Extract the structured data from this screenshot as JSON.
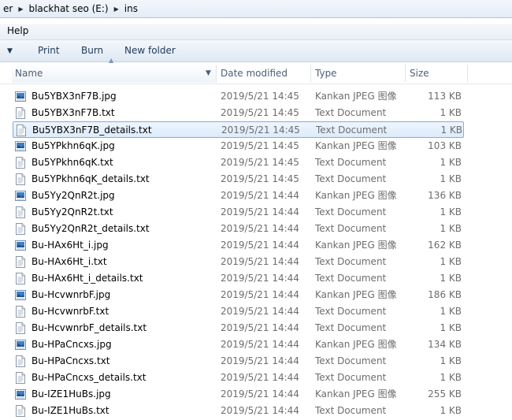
{
  "address": {
    "crumbs": [
      "er",
      "blackhat seo (E:)",
      "ins"
    ]
  },
  "menu": {
    "help": "Help"
  },
  "commands": {
    "print": "Print",
    "burn": "Burn",
    "new_folder": "New folder"
  },
  "columns": {
    "name": "Name",
    "date": "Date modified",
    "type": "Type",
    "size": "Size"
  },
  "files": [
    {
      "name": "Bu5YBX3nF7B.jpg",
      "date": "2019/5/21 14:45",
      "type": "Kankan JPEG 图像",
      "size": "113 KB",
      "icon": "jpeg-file-icon",
      "selected": false
    },
    {
      "name": "Bu5YBX3nF7B.txt",
      "date": "2019/5/21 14:45",
      "type": "Text Document",
      "size": "1 KB",
      "icon": "text-file-icon",
      "selected": false
    },
    {
      "name": "Bu5YBX3nF7B_details.txt",
      "date": "2019/5/21 14:45",
      "type": "Text Document",
      "size": "1 KB",
      "icon": "text-file-icon",
      "selected": true
    },
    {
      "name": "Bu5YPkhn6qK.jpg",
      "date": "2019/5/21 14:45",
      "type": "Kankan JPEG 图像",
      "size": "103 KB",
      "icon": "jpeg-file-icon",
      "selected": false
    },
    {
      "name": "Bu5YPkhn6qK.txt",
      "date": "2019/5/21 14:45",
      "type": "Text Document",
      "size": "1 KB",
      "icon": "text-file-icon",
      "selected": false
    },
    {
      "name": "Bu5YPkhn6qK_details.txt",
      "date": "2019/5/21 14:45",
      "type": "Text Document",
      "size": "1 KB",
      "icon": "text-file-icon",
      "selected": false
    },
    {
      "name": "Bu5Yy2QnR2t.jpg",
      "date": "2019/5/21 14:44",
      "type": "Kankan JPEG 图像",
      "size": "136 KB",
      "icon": "jpeg-file-icon",
      "selected": false
    },
    {
      "name": "Bu5Yy2QnR2t.txt",
      "date": "2019/5/21 14:44",
      "type": "Text Document",
      "size": "1 KB",
      "icon": "text-file-icon",
      "selected": false
    },
    {
      "name": "Bu5Yy2QnR2t_details.txt",
      "date": "2019/5/21 14:44",
      "type": "Text Document",
      "size": "1 KB",
      "icon": "text-file-icon",
      "selected": false
    },
    {
      "name": "Bu-HAx6Ht_i.jpg",
      "date": "2019/5/21 14:44",
      "type": "Kankan JPEG 图像",
      "size": "162 KB",
      "icon": "jpeg-file-icon",
      "selected": false
    },
    {
      "name": "Bu-HAx6Ht_i.txt",
      "date": "2019/5/21 14:44",
      "type": "Text Document",
      "size": "1 KB",
      "icon": "text-file-icon",
      "selected": false
    },
    {
      "name": "Bu-HAx6Ht_i_details.txt",
      "date": "2019/5/21 14:44",
      "type": "Text Document",
      "size": "1 KB",
      "icon": "text-file-icon",
      "selected": false
    },
    {
      "name": "Bu-HcvwnrbF.jpg",
      "date": "2019/5/21 14:44",
      "type": "Kankan JPEG 图像",
      "size": "186 KB",
      "icon": "jpeg-file-icon",
      "selected": false
    },
    {
      "name": "Bu-HcvwnrbF.txt",
      "date": "2019/5/21 14:44",
      "type": "Text Document",
      "size": "1 KB",
      "icon": "text-file-icon",
      "selected": false
    },
    {
      "name": "Bu-HcvwnrbF_details.txt",
      "date": "2019/5/21 14:44",
      "type": "Text Document",
      "size": "1 KB",
      "icon": "text-file-icon",
      "selected": false
    },
    {
      "name": "Bu-HPaCncxs.jpg",
      "date": "2019/5/21 14:44",
      "type": "Kankan JPEG 图像",
      "size": "134 KB",
      "icon": "jpeg-file-icon",
      "selected": false
    },
    {
      "name": "Bu-HPaCncxs.txt",
      "date": "2019/5/21 14:44",
      "type": "Text Document",
      "size": "1 KB",
      "icon": "text-file-icon",
      "selected": false
    },
    {
      "name": "Bu-HPaCncxs_details.txt",
      "date": "2019/5/21 14:44",
      "type": "Text Document",
      "size": "1 KB",
      "icon": "text-file-icon",
      "selected": false
    },
    {
      "name": "Bu-IZE1HuBs.jpg",
      "date": "2019/5/21 14:44",
      "type": "Kankan JPEG 图像",
      "size": "255 KB",
      "icon": "jpeg-file-icon",
      "selected": false
    },
    {
      "name": "Bu-IZE1HuBs.txt",
      "date": "2019/5/21 14:44",
      "type": "Text Document",
      "size": "1 KB",
      "icon": "text-file-icon",
      "selected": false
    }
  ],
  "colors": {
    "selection_border": "#84acdd",
    "selection_fill": "#dcebfc",
    "header_text": "#4c607a",
    "secondary_text": "#6d6d6d",
    "command_text": "#1e395b"
  }
}
